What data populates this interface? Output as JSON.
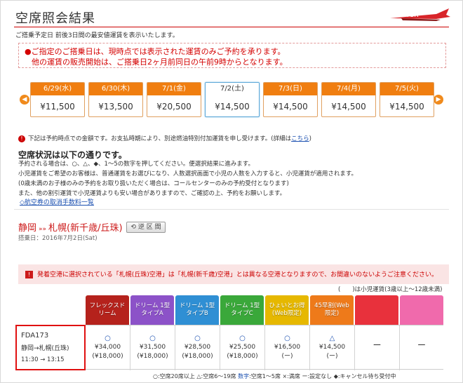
{
  "page": {
    "title": "空席照会結果",
    "subnote": "ご搭乗予定日 前後3日間の最安値運賃を表示いたします。",
    "logo_text": "FDA"
  },
  "notice": {
    "line1": "●ご指定のご搭乗日は、現時点では表示された運賃のみご予約を承ります。",
    "line2": "他の運賃の販売開始は、ご搭乗日2ヶ月前同日の午前9時からとなります。"
  },
  "date_nav": {
    "prev_icon": "chevron-left-icon",
    "next_icon": "chevron-right-icon",
    "cards": [
      {
        "date": "6/29(水)",
        "price": "¥11,500"
      },
      {
        "date": "6/30(木)",
        "price": "¥13,500"
      },
      {
        "date": "7/1(金)",
        "price": "¥20,500"
      },
      {
        "date": "7/2(土)",
        "price": "¥14,500",
        "selected": true
      },
      {
        "date": "7/3(日)",
        "price": "¥14,500"
      },
      {
        "date": "7/4(月)",
        "price": "¥14,500"
      },
      {
        "date": "7/5(火)",
        "price": "¥14,500"
      }
    ]
  },
  "info": {
    "text": "下記は予約時点での金額です。お支払時期により、別途燃油特別付加運賃を申し受けます。(詳細は",
    "link": "こちら",
    "close": ")"
  },
  "availability": {
    "title": "空席状況は以下の通りです。",
    "lines": [
      "予約される場合は、○、△、◆、1〜5の数字を押してください。便選択結果に進みます。",
      "小児運賃をご希望のお客様は、普通運賃をお選びになり、人数選択画面で小児の人数を入力すると、小児運賃が適用されます。",
      "(0歳未満のお子様のみの予約をお取り扱いただく場合は、コールセンターのみの予約受付となります)",
      "また、他の割引運賃で小児運賃よりも安い場合がありますので、ご確認の上、予約をお願いします。"
    ],
    "fee_link": "◇航空券の取消手数料一覧"
  },
  "route": {
    "from": "静岡",
    "arrow": "»»",
    "to": "札幌(新千歳/丘珠)",
    "reverse_button": "逆 区 間",
    "boarding_date": "搭乗日：2016年7月2日(Sat)"
  },
  "warning": {
    "text": "発着空港に選択されている「札幌(丘珠)空港」は「札幌(新千歳)空港」とは異なる空港となりますので、お間違いのないようご注意ください。"
  },
  "child_note": "(　　)は小児運賃(3歳以上〜12歳未満)",
  "fares": {
    "headers": [
      {
        "label": "フレックスドリーム",
        "color": "#b5221c"
      },
      {
        "label": "ドリーム 1型タイプA",
        "color": "#8c52c8"
      },
      {
        "label": "ドリーム 1型タイプB",
        "color": "#2f8fd4"
      },
      {
        "label": "ドリーム 1型タイプC",
        "color": "#3aa83a"
      },
      {
        "label": "ひょいとお得 (Web限定)",
        "color": "#e6b800"
      },
      {
        "label": "45早割(Web限定)",
        "color": "#ee7a1a"
      },
      {
        "label": "",
        "color": "#e8313c"
      },
      {
        "label": "",
        "color": "#f06aac"
      }
    ],
    "cells": [
      {
        "mark": "○",
        "adult": "¥34,000",
        "child": "(¥18,000)"
      },
      {
        "mark": "○",
        "adult": "¥31,500",
        "child": "(¥18,000)"
      },
      {
        "mark": "○",
        "adult": "¥28,500",
        "child": "(¥18,000)"
      },
      {
        "mark": "○",
        "adult": "¥25,500",
        "child": "(¥18,000)"
      },
      {
        "mark": "○",
        "adult": "¥16,500",
        "child": "(ー)"
      },
      {
        "mark": "△",
        "adult": "¥14,500",
        "child": "(ー)"
      },
      {
        "mark": "ー",
        "adult": "",
        "child": ""
      },
      {
        "mark": "ー",
        "adult": "",
        "child": ""
      }
    ]
  },
  "flight": {
    "number": "FDA173",
    "route": "静岡→札幌(丘珠)",
    "time": "11:30 → 13:15"
  },
  "legend": {
    "circle": "○:空席20席以上",
    "triangle": "△:空席6〜19席",
    "number": "数字",
    "number_desc": ":空席1〜5席",
    "full": "×:満席",
    "none": "ー:設定なし",
    "cancel": "◆:キャンセル待ち受付中"
  },
  "colors": {
    "accent_red": "#cc0000",
    "date_orange": "#f07e10",
    "link_blue": "#1a4fb0"
  }
}
